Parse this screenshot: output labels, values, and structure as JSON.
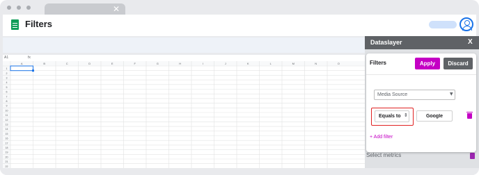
{
  "browser": {
    "tab_close": "✕"
  },
  "app": {
    "title": "Filters"
  },
  "formula_bar": {
    "cell_ref": "A1",
    "fx": "fx"
  },
  "grid": {
    "columns": [
      "A",
      "B",
      "C",
      "D",
      "E",
      "F",
      "G",
      "H",
      "I",
      "J",
      "K",
      "L",
      "M",
      "N",
      "O"
    ],
    "rows": [
      "1",
      "2",
      "3",
      "4",
      "5",
      "6",
      "7",
      "8",
      "9",
      "10",
      "11",
      "12",
      "13",
      "14",
      "15",
      "16",
      "17",
      "18",
      "19",
      "20",
      "21",
      "22"
    ]
  },
  "side_panel": {
    "title": "Dataslayer",
    "close": "X",
    "select_metrics": "Select metrics"
  },
  "filters_modal": {
    "title": "Filters",
    "apply": "Apply",
    "discard": "Discard",
    "source_value": "Media Source",
    "operator_value": "Equals to",
    "filter_value": "Google",
    "add_filter": "+ Add filter"
  },
  "colors": {
    "brand_magenta": "#c400c4",
    "highlight_red": "#e02020",
    "panel_header": "#5f6266"
  }
}
